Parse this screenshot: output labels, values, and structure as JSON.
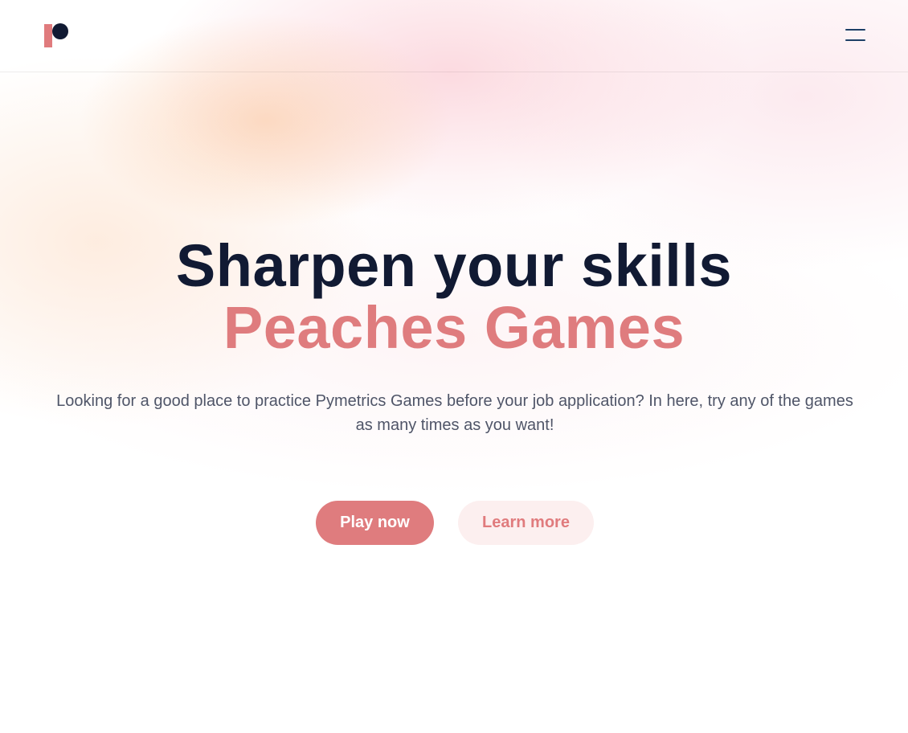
{
  "header": {
    "logo_icon": "pymetrics-logo-icon",
    "menu_icon": "hamburger-menu-icon"
  },
  "hero": {
    "title_line1": "Sharpen your skills",
    "title_line2": "Peaches Games",
    "subtitle": "Looking for a good place to practice Pymetrics Games before your job application? In here, try any of the games as many times as you want!",
    "primary_button": "Play now",
    "secondary_button": "Learn more"
  },
  "colors": {
    "accent": "#df7c7e",
    "heading": "#111a33",
    "body_text": "#4f5568",
    "secondary_button_bg": "#fcefef",
    "menu_icon": "#1d3f66"
  }
}
